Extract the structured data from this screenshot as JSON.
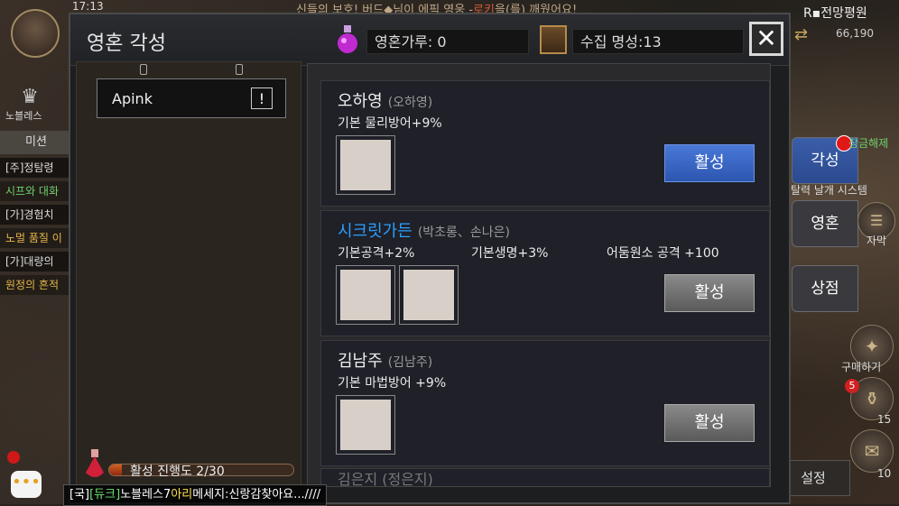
{
  "hud": {
    "time": "17:13",
    "notice_pre": "신들의 보호! 버드",
    "notice_mid": "님이 에픽 영웅 -",
    "notice_hero": "로키",
    "notice_post": "을(를) 깨웠어요!",
    "guild_name": "노블레스",
    "mission_tab": "미션",
    "quests": [
      {
        "text": "[주]정탐령",
        "color": "w"
      },
      {
        "text": "시프와 대화",
        "color": "g"
      },
      {
        "text": "[가]경험치",
        "color": "w"
      },
      {
        "text": "노멀 품질 이",
        "color": "y"
      },
      {
        "text": "[가]대량의",
        "color": "w"
      },
      {
        "text": "원정의 흔적",
        "color": "y"
      }
    ],
    "region": "R▪전망평원",
    "coords": "66,190",
    "side_buttons": [
      "각성",
      "영혼",
      "상점"
    ],
    "side_labels": [
      "잠금해제",
      "탈력 날개 시스템",
      "자막",
      "구매하기"
    ],
    "counts": [
      "15",
      "10"
    ],
    "badge": "5",
    "chat_channel": "[국]",
    "chat_user": "[듀크]",
    "chat_pre": "노블레스7",
    "chat_name": "아리",
    "chat_msg": "메세지:신랑감찾아요...////",
    "chat_icon": "•••",
    "settings": "설정"
  },
  "dialog": {
    "title": "영혼 각성",
    "soul_powder_label": "영혼가루: 0",
    "collection_label": "수집 명성:13",
    "close_glyph": "✕",
    "group": {
      "name": "Apink",
      "alert": "!"
    },
    "progress": {
      "label": "활성 진행도 2/30",
      "current": 2,
      "total": 30
    },
    "cards": [
      {
        "name": "오하영",
        "sub": "(오하영)",
        "stats": [
          "기본 물리방어+9%"
        ],
        "photos": 1,
        "button": "활성",
        "button_style": "blue",
        "name_color": "white"
      },
      {
        "name": "시크릿가든",
        "sub": "(박초롱、손나은)",
        "stats": [
          "기본공격+2%",
          "기본생명+3%",
          "어둠원소 공격 +100"
        ],
        "photos": 2,
        "button": "활성",
        "button_style": "gray",
        "name_color": "blue"
      },
      {
        "name": "김남주",
        "sub": "(김남주)",
        "stats": [
          "기본 마법방어 +9%"
        ],
        "photos": 1,
        "button": "활성",
        "button_style": "gray",
        "name_color": "white"
      }
    ],
    "peek_text": "김은지 (정은지)"
  }
}
